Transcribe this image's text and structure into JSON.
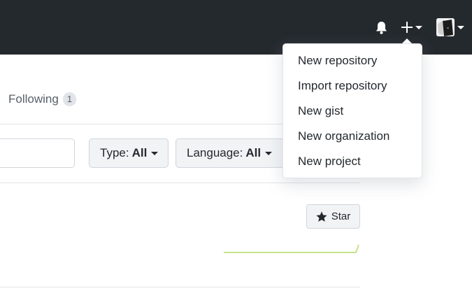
{
  "header": {
    "icons": [
      "bell-icon",
      "plus-icon",
      "chevron-down-icon",
      "avatar"
    ],
    "background": "#24292e"
  },
  "profile_nav": {
    "following_label": "Following",
    "following_count": "1"
  },
  "filters": {
    "search_placeholder": "",
    "type_label": "Type:",
    "type_value": "All",
    "language_label": "Language:",
    "language_value": "All"
  },
  "repo": {
    "star_label": "Star",
    "sparkline_color": "#c6e48b"
  },
  "create_menu": {
    "items": [
      {
        "label": "New repository"
      },
      {
        "label": "Import repository"
      },
      {
        "label": "New gist"
      },
      {
        "label": "New organization"
      },
      {
        "label": "New project"
      }
    ]
  }
}
